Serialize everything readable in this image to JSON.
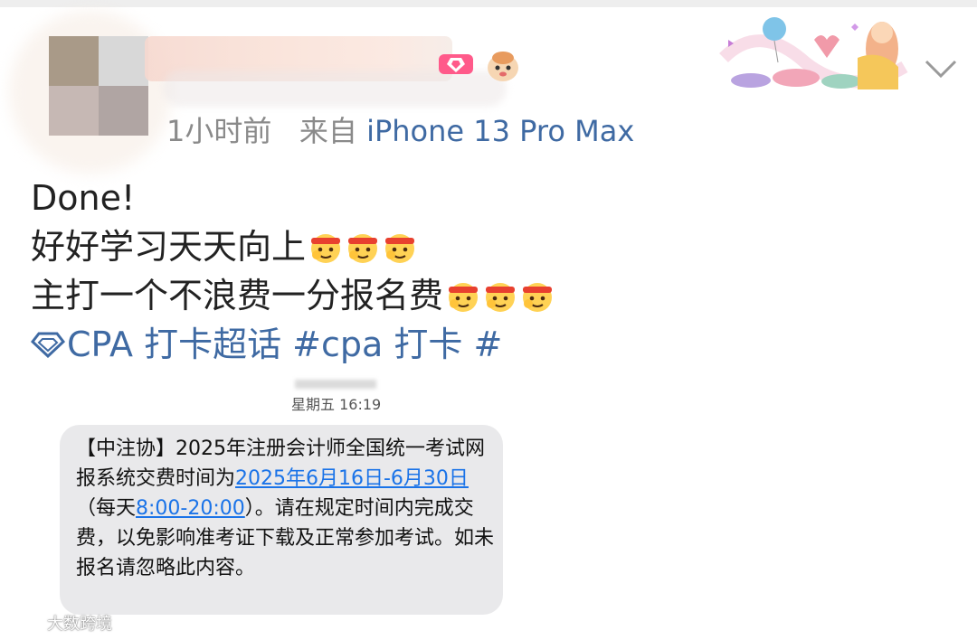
{
  "post": {
    "meta_time": "1小时前",
    "meta_from": "来自",
    "meta_device": "iPhone 13 Pro Max",
    "lines": [
      "Done!",
      "好好学习天天向上",
      "主打一个不浪费一分报名费"
    ],
    "tag_text": "CPA 打卡超话 #cpa 打卡 #"
  },
  "sms": {
    "time": "星期五 16:19",
    "parts": [
      "【中注协】2025年注册会计师全国统一考试网报系统交费时间为",
      "2025年6月16日-6月30日",
      "（每天",
      "8:00-20:00",
      "）。请在规定时间内完成交费，以免影响准考证下载及正常参加考试。如未报名请忽略此内容。"
    ]
  },
  "watermark": {
    "text": "大数跨境"
  },
  "colors": {
    "link_blue": "#3f6aa3",
    "sms_link": "#1a73e8",
    "bubble_bg": "#e9e9eb",
    "meta_gray": "#8a8a8a"
  }
}
